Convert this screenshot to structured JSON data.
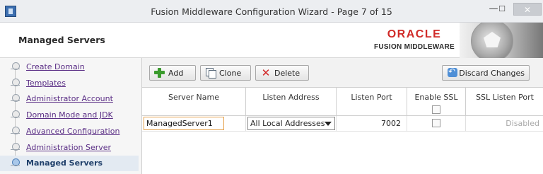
{
  "window": {
    "title": "Fusion Middleware Configuration Wizard - Page 7 of 15",
    "controls": {
      "minimize": "—",
      "maximize": "☐",
      "close": "✕"
    },
    "icon": "app-window-icon"
  },
  "header": {
    "page_title": "Managed Servers",
    "brand": {
      "name": "ORACLE",
      "sub": "FUSION MIDDLEWARE",
      "color": "#d02a27"
    }
  },
  "nav": {
    "items": [
      {
        "label": "Create Domain",
        "active": false
      },
      {
        "label": "Templates",
        "active": false
      },
      {
        "label": "Administrator Account",
        "active": false
      },
      {
        "label": "Domain Mode and JDK",
        "active": false
      },
      {
        "label": "Advanced Configuration",
        "active": false
      },
      {
        "label": "Administration Server",
        "active": false
      },
      {
        "label": "Managed Servers",
        "active": true
      }
    ]
  },
  "toolbar": {
    "add_label": "Add",
    "clone_label": "Clone",
    "delete_label": "Delete",
    "discard_label": "Discard Changes"
  },
  "table": {
    "columns": [
      "Server Name",
      "Listen Address",
      "Listen Port",
      "Enable SSL",
      "SSL Listen Port"
    ],
    "rows": [
      {
        "server_name": "ManagedServer1",
        "listen_address": "All Local Addresses",
        "listen_port": "7002",
        "enable_ssl": false,
        "ssl_listen_port": "Disabled"
      }
    ]
  },
  "colors": {
    "accent": "#d02a27",
    "link": "#5b2f86",
    "focus_border": "#e5a24d",
    "active_nav_bg": "#e3eaf2"
  }
}
